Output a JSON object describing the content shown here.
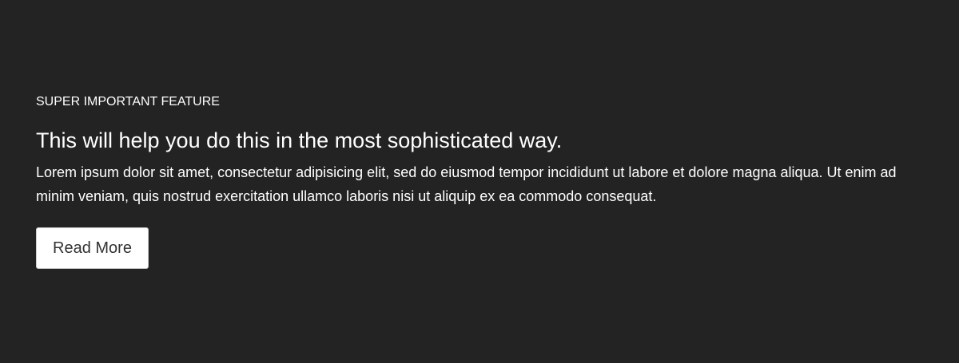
{
  "feature": {
    "eyebrow": "SUPER IMPORTANT FEATURE",
    "headline": "This will help you do this in the most sophisticated way.",
    "body": "Lorem ipsum dolor sit amet, consectetur adipisicing elit, sed do eiusmod tempor incididunt ut labore et dolore magna aliqua. Ut enim ad minim veniam, quis nostrud exercitation ullamco laboris nisi ut aliquip ex ea commodo consequat.",
    "button_label": "Read More"
  },
  "colors": {
    "background": "#232323",
    "text": "#ffffff",
    "button_background": "#ffffff",
    "button_text": "#333333"
  }
}
